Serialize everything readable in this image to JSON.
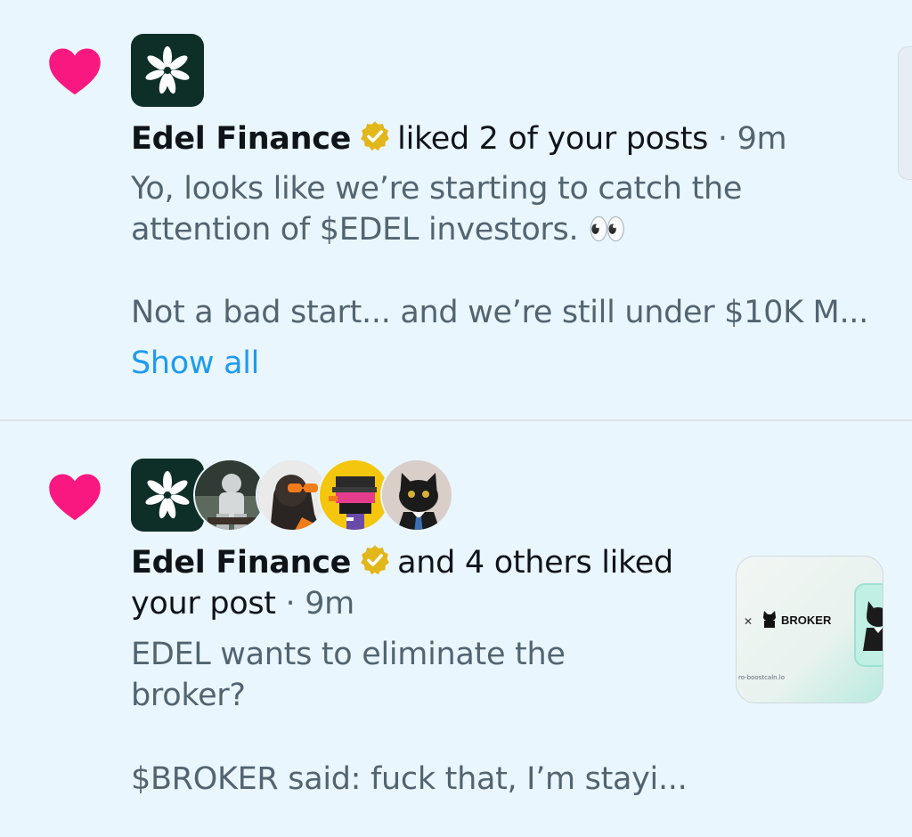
{
  "notifications": [
    {
      "type": "like",
      "icon": "heart-icon",
      "actor_name": "Edel Finance",
      "action": "liked 2 of your posts",
      "separator": "·",
      "time": "9m",
      "post_lines": [
        "Yo, looks like we’re starting to catch the",
        "attention of $EDEL investors. 👀",
        "",
        "Not a bad start... and we’re still under $10K M..."
      ],
      "show_all": "Show all"
    },
    {
      "type": "like",
      "icon": "heart-icon",
      "actor_name": "Edel Finance",
      "action_line1": "and 4 others liked",
      "action_line2": "your post",
      "separator": "·",
      "time": "9m",
      "post_lines": [
        "EDEL wants to eliminate the",
        "broker?",
        "",
        "$BROKER said: fuck that, I’m stayi..."
      ],
      "media": {
        "x_mark": "✕",
        "label": "BROKER",
        "small_text": "ro-boostcaln.lo"
      }
    }
  ],
  "colors": {
    "background": "#eaf6fd",
    "heart": "#f91880",
    "verified": "#e2b719",
    "link": "#1d9bf0",
    "muted": "#536471"
  }
}
